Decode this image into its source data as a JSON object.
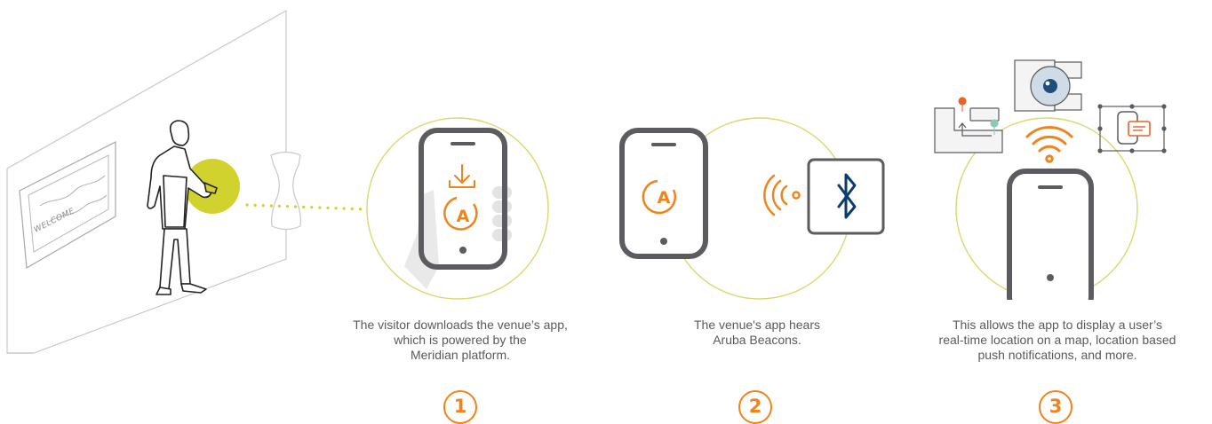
{
  "scene": {
    "welcome_sign": "WELCOME",
    "app_letter": "A",
    "bluetooth_icon": "bluetooth-icon",
    "colors": {
      "accent": "#f0841c",
      "phone": "#5b5b60",
      "highlight": "#d2d22e",
      "halo": "#d9d970",
      "line": "#c8c8c8",
      "bluetooth": "#0b3d6b",
      "camera": "#1f4e79"
    }
  },
  "steps": [
    {
      "number": "1",
      "caption_lines": [
        "The visitor downloads the venue’s app,",
        "which is powered by the",
        "Meridian platform."
      ]
    },
    {
      "number": "2",
      "caption_lines": [
        "The venue's app hears",
        "Aruba Beacons."
      ]
    },
    {
      "number": "3",
      "caption_lines": [
        "This allows the app to display a user’s",
        "real-time location on a map, location based",
        "push notifications, and more."
      ]
    }
  ]
}
